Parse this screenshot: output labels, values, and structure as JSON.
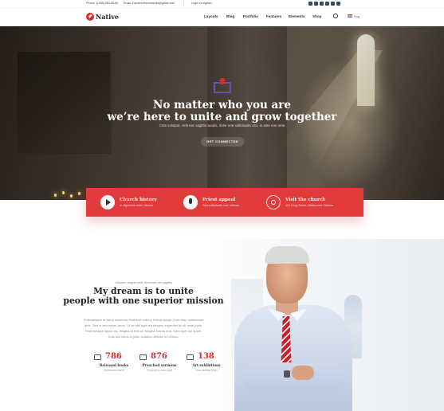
{
  "topbar": {
    "phone": "Phone: 1(306) 454-58-66",
    "email": "Email: Dynamicthemeworks@gmail.com",
    "login": "Login or register"
  },
  "nav": {
    "logo": "Native",
    "items": [
      "Layouts",
      "Blog",
      "Portfolio",
      "Features",
      "Elements",
      "Shop"
    ],
    "language": "Eng"
  },
  "hero": {
    "title_line1": "No matter who you are",
    "title_line2": "we’re here to unite and grow together",
    "subtitle": "Cras volutpat, velit nec sagittis iaculis, dolor erat sollicitudin orci, in ante non urna",
    "button": "GET CONNECTED"
  },
  "features": [
    {
      "title": "Church history",
      "subtitle": "In dignissim enim ultrices",
      "icon": "play-icon"
    },
    {
      "title": "Priest appeal",
      "subtitle": "Sed sollicitudin non ultrices",
      "icon": "microphone-icon"
    },
    {
      "title": "Visit the church",
      "subtitle": "121 King Street, Melbourne Victoria",
      "icon": "location-pin-icon"
    }
  ],
  "about": {
    "eyebrow": "Aliquam augue velit, tincidunt vel sagittis",
    "title_line1": "My dream is to unite",
    "title_line2": "people with one superior mission",
    "paragraph": [
      "Pellentesque at lacus maximus, tincidunt nulla a, finibus turpis. Duis vitae malesuada",
      "ante. Sed in accumsan lacus. Ut ac nisl eget leo tempus imperdiet ac sit amet justo.",
      "Pellentesque ligula nisl, fringilla at felis ut, fringilla finibus erat. Nam eget dui quam.",
      "Duis sed lacus in justo sodales ultricies in ut risus."
    ],
    "stats": [
      {
        "value": "786",
        "label": "Released books",
        "sub": "Sollicitudin libero"
      },
      {
        "value": "876",
        "label": "Preached sermons",
        "sub": "Placerat eu arcu eget"
      },
      {
        "value": "138",
        "label": "Art exhibitions",
        "sub": "Non ultricies enim"
      }
    ]
  },
  "colors": {
    "accent": "#e23b3b",
    "dark": "#222222"
  }
}
